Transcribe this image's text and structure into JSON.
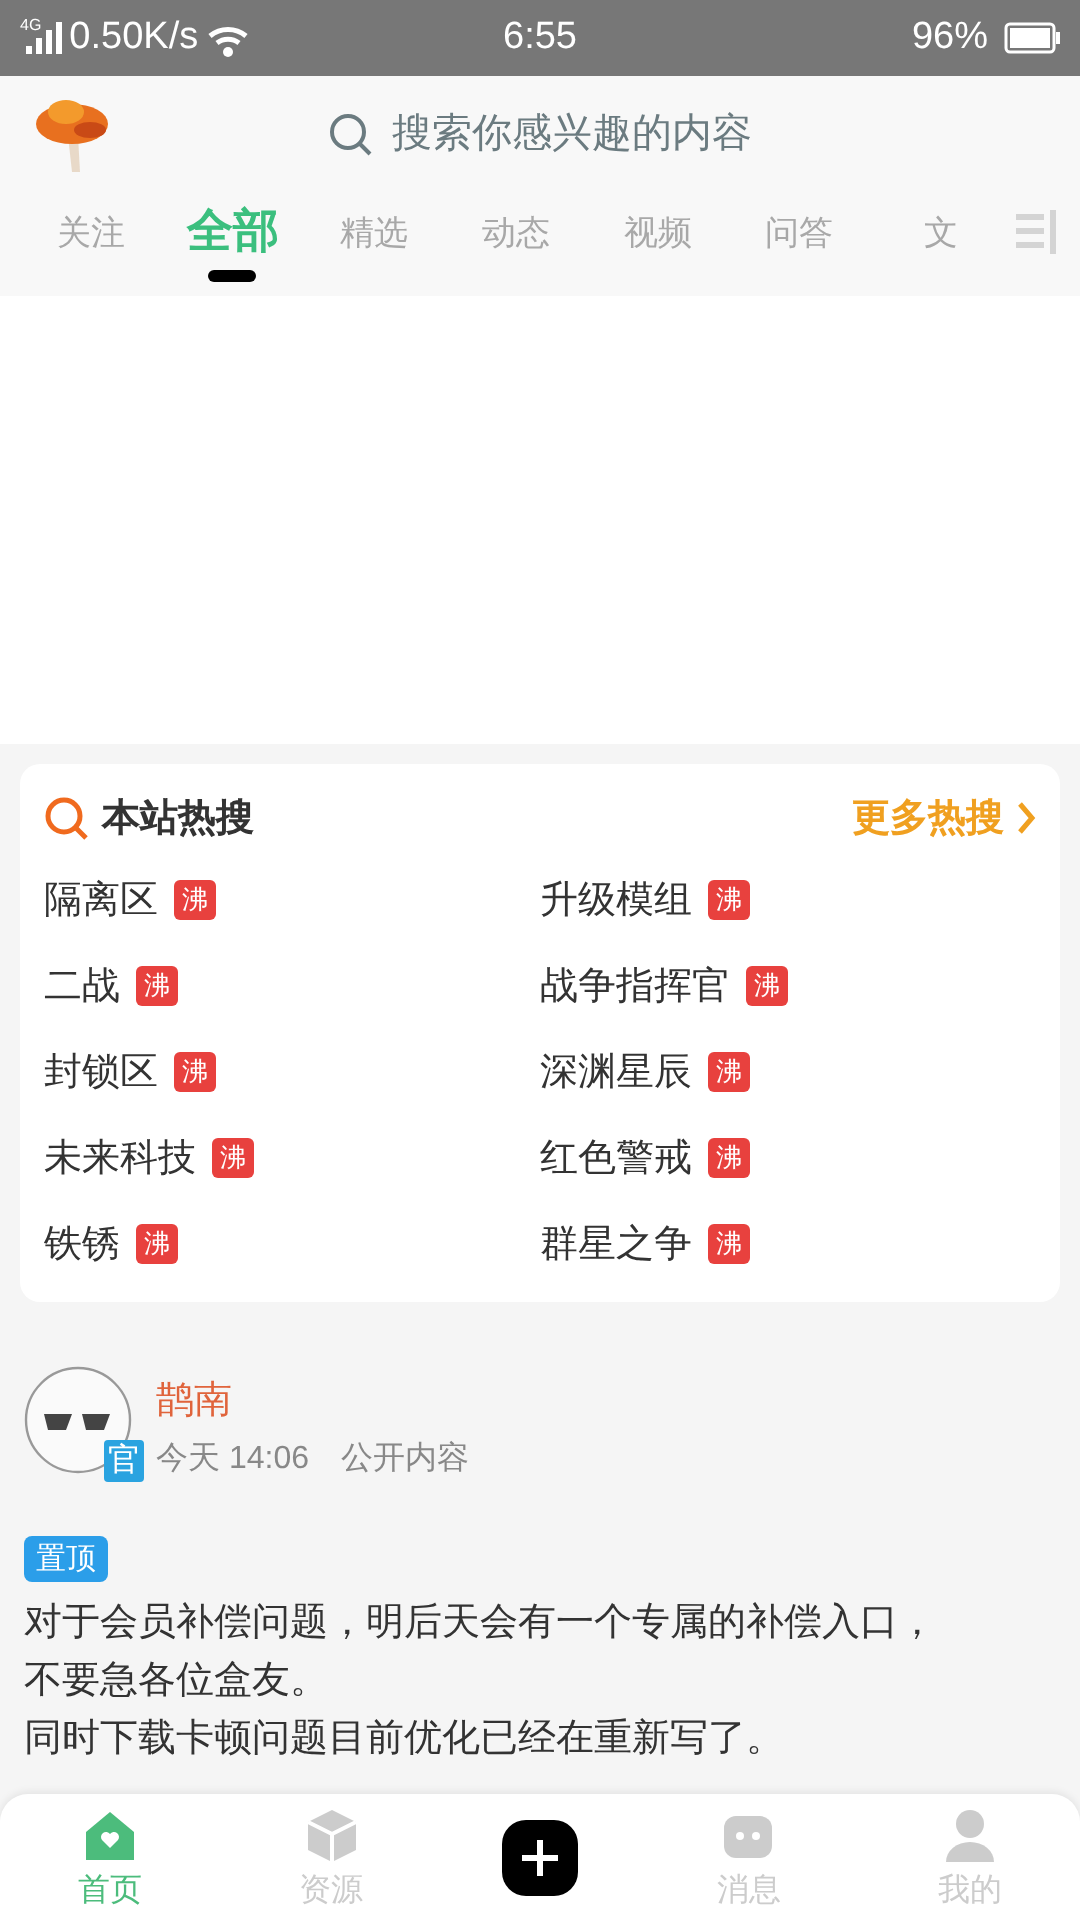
{
  "status_bar": {
    "network": "4G",
    "speed": "0.50K/s",
    "time": "6:55",
    "battery": "96%"
  },
  "search": {
    "placeholder": "搜索你感兴趣的内容"
  },
  "tabs": [
    {
      "label": "关注",
      "selected": false
    },
    {
      "label": "全部",
      "selected": true
    },
    {
      "label": "精选",
      "selected": false
    },
    {
      "label": "动态",
      "selected": false
    },
    {
      "label": "视频",
      "selected": false
    },
    {
      "label": "问答",
      "selected": false
    },
    {
      "label": "文",
      "selected": false
    }
  ],
  "hot_search": {
    "title": "本站热搜",
    "more": "更多热搜",
    "items": [
      {
        "label": "隔离区",
        "badge": "沸"
      },
      {
        "label": "升级模组",
        "badge": "沸"
      },
      {
        "label": "二战",
        "badge": "沸"
      },
      {
        "label": "战争指挥官",
        "badge": "沸"
      },
      {
        "label": "封锁区",
        "badge": "沸"
      },
      {
        "label": "深渊星辰",
        "badge": "沸"
      },
      {
        "label": "未来科技",
        "badge": "沸"
      },
      {
        "label": "红色警戒",
        "badge": "沸"
      },
      {
        "label": "铁锈",
        "badge": "沸"
      },
      {
        "label": "群星之争",
        "badge": "沸"
      }
    ]
  },
  "post": {
    "author": "鹊南",
    "badge": "官",
    "time": "今天 14:06",
    "visibility": "公开内容",
    "tag": "置顶",
    "paragraphs": [
      "对于会员补偿问题，明后天会有一个专属的补偿入口，不要急各位盒友。",
      "同时下载卡顿问题目前优化已经在重新写了。"
    ]
  },
  "bottom_nav": [
    {
      "kind": "tab",
      "label": "首页",
      "selected": true
    },
    {
      "kind": "tab",
      "label": "资源",
      "selected": false
    },
    {
      "kind": "add"
    },
    {
      "kind": "tab",
      "label": "消息",
      "selected": false
    },
    {
      "kind": "tab",
      "label": "我的",
      "selected": false
    }
  ]
}
